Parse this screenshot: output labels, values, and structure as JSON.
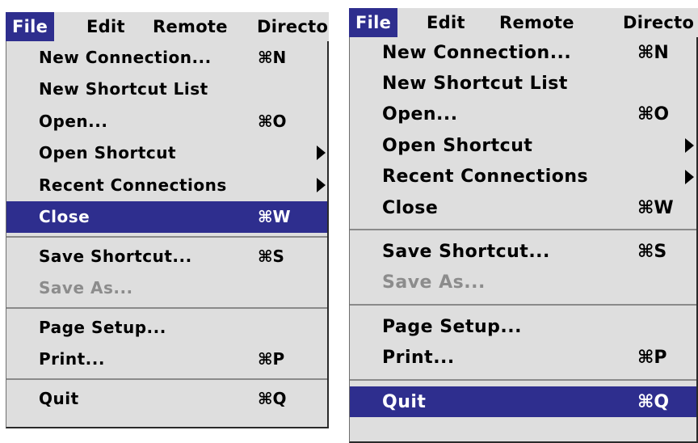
{
  "colors": {
    "menu_background": "#dedede",
    "highlight": "#2e2e8e",
    "disabled_text": "#8c8c8c",
    "separator": "#8a8a8a",
    "text": "#000000"
  },
  "menus": [
    {
      "menubar": [
        {
          "label": "File",
          "selected": true
        },
        {
          "label": "Edit"
        },
        {
          "label": "Remote"
        },
        {
          "label": "Director"
        }
      ],
      "items": [
        {
          "type": "item",
          "label": "New Connection...",
          "shortcut": "⌘N"
        },
        {
          "type": "item",
          "label": "New Shortcut List"
        },
        {
          "type": "item",
          "label": "Open...",
          "shortcut": "⌘O"
        },
        {
          "type": "item",
          "label": "Open Shortcut",
          "submenu": true,
          "icon": "submenu-arrow-icon"
        },
        {
          "type": "item",
          "label": "Recent Connections",
          "submenu": true,
          "icon": "submenu-arrow-icon"
        },
        {
          "type": "item",
          "label": "Close",
          "shortcut": "⌘W",
          "highlighted": true
        },
        {
          "type": "separator"
        },
        {
          "type": "item",
          "label": "Save Shortcut...",
          "shortcut": "⌘S"
        },
        {
          "type": "item",
          "label": "Save As...",
          "disabled": true
        },
        {
          "type": "separator"
        },
        {
          "type": "item",
          "label": "Page Setup..."
        },
        {
          "type": "item",
          "label": "Print...",
          "shortcut": "⌘P"
        },
        {
          "type": "separator"
        },
        {
          "type": "item",
          "label": "Quit",
          "shortcut": "⌘Q"
        }
      ]
    },
    {
      "menubar": [
        {
          "label": "File",
          "selected": true
        },
        {
          "label": "Edit"
        },
        {
          "label": "Remote"
        },
        {
          "label": "Directo"
        }
      ],
      "items": [
        {
          "type": "item",
          "label": "New Connection...",
          "shortcut": "⌘N"
        },
        {
          "type": "item",
          "label": "New Shortcut List"
        },
        {
          "type": "item",
          "label": "Open...",
          "shortcut": "⌘O"
        },
        {
          "type": "item",
          "label": "Open Shortcut",
          "submenu": true,
          "icon": "submenu-arrow-icon"
        },
        {
          "type": "item",
          "label": "Recent Connections",
          "submenu": true,
          "icon": "submenu-arrow-icon"
        },
        {
          "type": "item",
          "label": "Close",
          "shortcut": "⌘W"
        },
        {
          "type": "separator"
        },
        {
          "type": "item",
          "label": "Save Shortcut...",
          "shortcut": "⌘S"
        },
        {
          "type": "item",
          "label": "Save As...",
          "disabled": true
        },
        {
          "type": "separator"
        },
        {
          "type": "item",
          "label": "Page Setup..."
        },
        {
          "type": "item",
          "label": "Print...",
          "shortcut": "⌘P"
        },
        {
          "type": "separator"
        },
        {
          "type": "item",
          "label": "Quit",
          "shortcut": "⌘Q",
          "highlighted": true
        }
      ]
    }
  ]
}
